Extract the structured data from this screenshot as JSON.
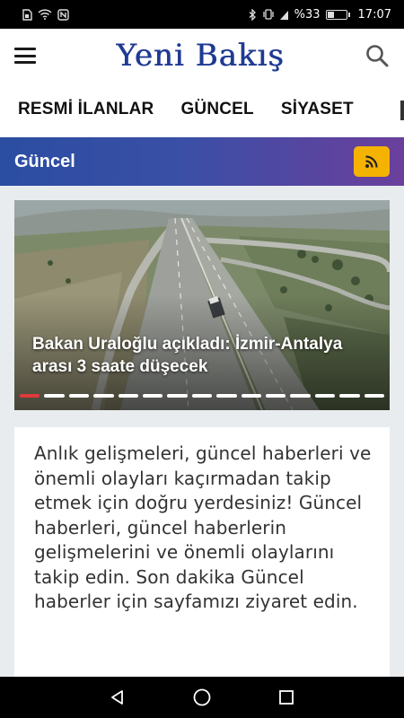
{
  "status_bar": {
    "left_icons": [
      "sim-icon",
      "wifi-icon",
      "nfc-icon"
    ],
    "right_icons": [
      "bluetooth-icon",
      "vibrate-icon",
      "signal-icon"
    ],
    "battery_percent": "%33",
    "battery_level": 0.33,
    "time": "17:07"
  },
  "header": {
    "logo_text": "Yeni Bakış",
    "logo_color": "#1f3a93"
  },
  "categories": [
    {
      "label": "RESMİ İLANLAR"
    },
    {
      "label": "GÜNCEL"
    },
    {
      "label": "SİYASET"
    }
  ],
  "section": {
    "title": "Güncel",
    "accent": "#f5b301"
  },
  "slider": {
    "caption": "Bakan Uraloğlu açıkladı: İzmir-Antalya arası 3 saate düşecek",
    "slide_count": 15,
    "active_index": 0
  },
  "card": {
    "text": "Anlık gelişmeleri, güncel haberleri ve önemli olayları kaçırmadan takip etmek için doğru yerdesiniz! Güncel haberleri, güncel haberlerin gelişmelerini ve önemli olaylarını takip edin. Son dakika Güncel haberler için sayfamızı ziyaret edin."
  }
}
